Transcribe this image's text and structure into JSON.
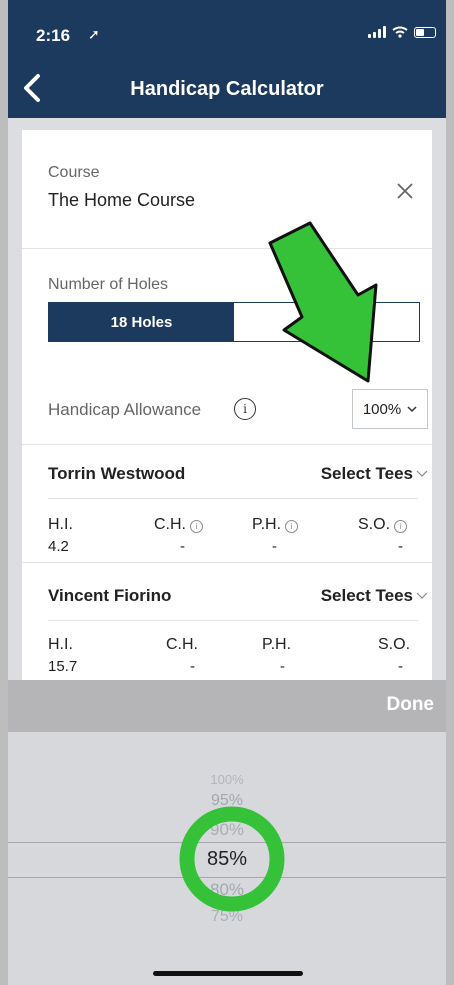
{
  "status": {
    "time": "2:16"
  },
  "header": {
    "title": "Handicap Calculator"
  },
  "course": {
    "label": "Course",
    "name": "The Home Course"
  },
  "holes": {
    "label": "Number of Holes",
    "selected": "18 Holes"
  },
  "allowance": {
    "label": "Handicap Allowance",
    "value": "100%"
  },
  "players": [
    {
      "name": "Torrin Westwood",
      "select_tees": "Select Tees",
      "hi_label": "H.I.",
      "hi": "4.2",
      "ch_label": "C.H.",
      "ch": "-",
      "ph_label": "P.H.",
      "ph": "-",
      "so_label": "S.O.",
      "so": "-"
    },
    {
      "name": "Vincent Fiorino",
      "select_tees": "Select Tees",
      "hi_label": "H.I.",
      "hi": "15.7",
      "ch_label": "C.H.",
      "ch": "-",
      "ph_label": "P.H.",
      "ph": "-",
      "so_label": "S.O.",
      "so": "-"
    }
  ],
  "picker": {
    "done_label": "Done",
    "options": [
      "100%",
      "95%",
      "90%",
      "85%",
      "80%",
      "75%"
    ],
    "selected": "85%"
  },
  "colors": {
    "navy": "#1c3a5d",
    "arrow": "#35c238",
    "ring": "#35c238"
  }
}
